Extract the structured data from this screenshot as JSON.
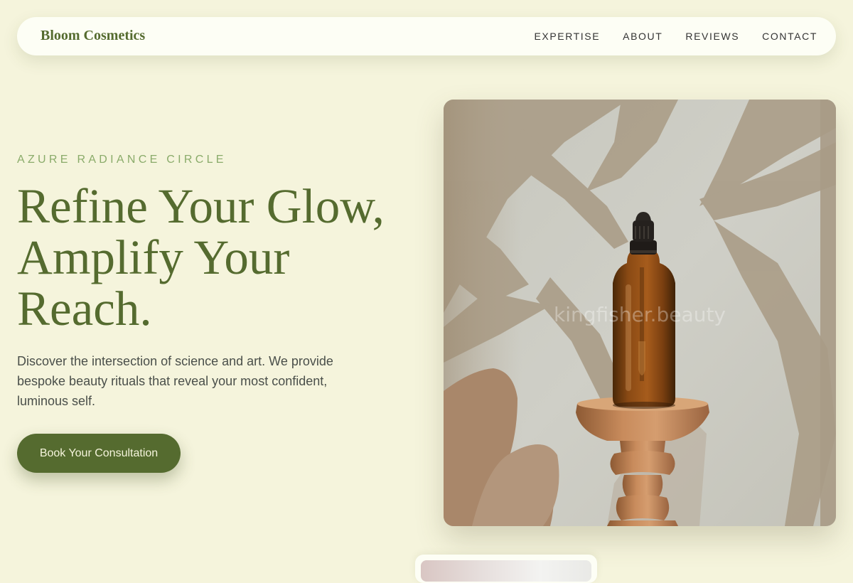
{
  "nav": {
    "brand": "Bloom Cosmetics",
    "links": [
      {
        "label": "EXPERTISE"
      },
      {
        "label": "ABOUT"
      },
      {
        "label": "REVIEWS"
      },
      {
        "label": "CONTACT"
      }
    ]
  },
  "hero": {
    "eyebrow": "AZURE RADIANCE CIRCLE",
    "headline_lines": [
      "Refine Your Glow,",
      "Amplify Your",
      "Reach."
    ],
    "description": "Discover the intersection of science and art. We provide bespoke beauty rituals that reveal your most confident, luminous self.",
    "cta_label": "Book Your Consultation",
    "image": {
      "subject": "amber serum dropper bottle on wooden pedestal",
      "watermark": "kingfisher.beauty"
    }
  },
  "colors": {
    "background": "#f5f4dc",
    "accent": "#556b2f",
    "eyebrow": "#8aab6a",
    "nav_background": "#fdfef5",
    "body_text": "#4a4f4a"
  }
}
